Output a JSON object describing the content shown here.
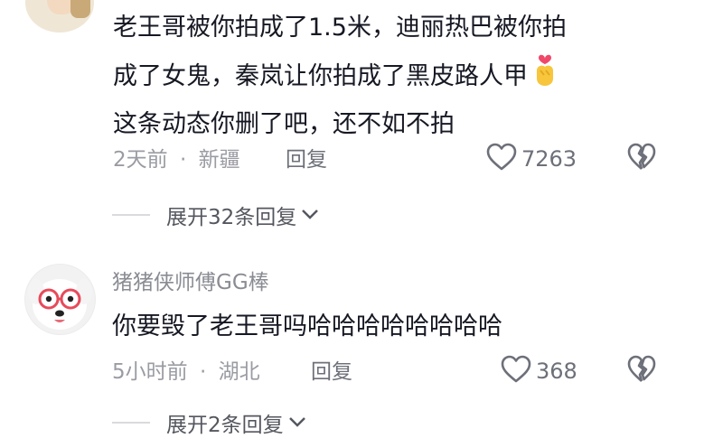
{
  "comments": [
    {
      "lines": [
        "老王哥被你拍成了1.5米，迪丽热巴被你拍",
        "成了女鬼，秦岚让你拍成了黑皮路人甲",
        "这条动态你删了吧，还不如不拍"
      ],
      "emoji_icon": "heart-hand-emoji-icon",
      "time": "2天前",
      "location": "新疆",
      "reply_label": "回复",
      "likes": "7263",
      "expand_label": "展开32条回复"
    },
    {
      "author": "猪猪侠师傅GG棒",
      "text": "你要毁了老王哥吗哈哈哈哈哈哈哈哈",
      "time": "5小时前",
      "location": "湖北",
      "reply_label": "回复",
      "likes": "368",
      "expand_label": "展开2条回复"
    }
  ],
  "separator": "·",
  "colors": {
    "text": "#161823",
    "meta": "#9a9ca3",
    "line": "#d9dade"
  }
}
